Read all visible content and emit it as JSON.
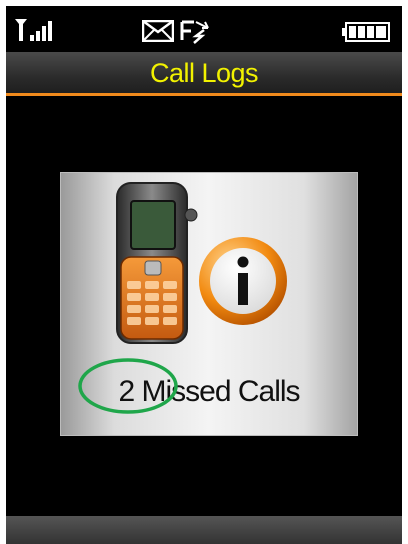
{
  "status_bar": {
    "icons": [
      "signal-strength-icon",
      "message-icon",
      "call-forward-icon",
      "battery-icon"
    ]
  },
  "header": {
    "title": "Call Logs"
  },
  "popup": {
    "message": "2 Missed Calls",
    "icons": [
      "mobile-phone-icon",
      "info-icon"
    ]
  },
  "colors": {
    "title_text": "#f2f200",
    "accent_orange": "#f08a1c",
    "annotation_green": "#1fa64a"
  }
}
